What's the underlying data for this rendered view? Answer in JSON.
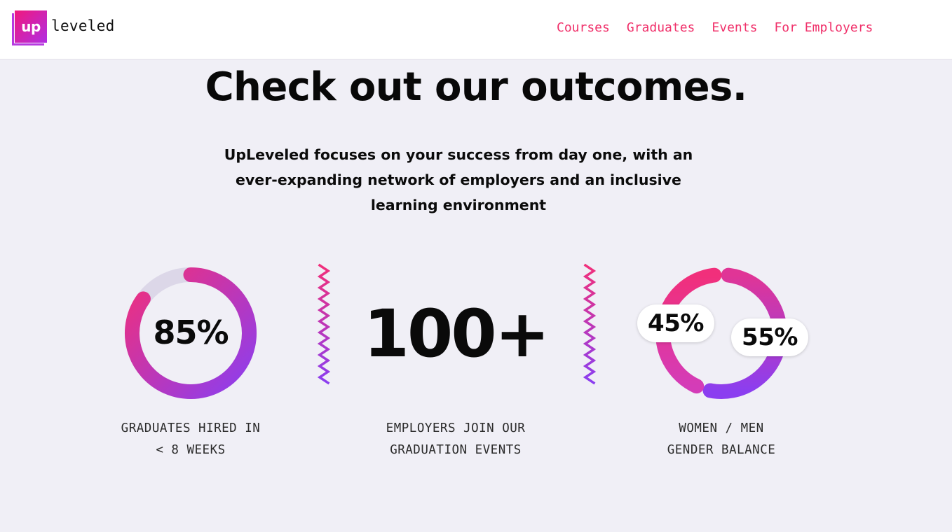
{
  "brand": {
    "logo_mark": "up",
    "logo_word": "leveled"
  },
  "nav": {
    "items": [
      {
        "label": "Courses"
      },
      {
        "label": "Graduates"
      },
      {
        "label": "Events"
      },
      {
        "label": "For Employers"
      }
    ]
  },
  "hero": {
    "title": "Check out our outcomes.",
    "intro": "UpLeveled focuses on your success from day one, with an ever-expanding network of employers and an inclusive learning environment"
  },
  "stats": {
    "hired": {
      "value_label": "85%",
      "fraction": 0.85,
      "caption_line1": "GRADUATES HIRED IN",
      "caption_line2": "< 8 WEEKS"
    },
    "employers": {
      "value_label": "100+",
      "caption_line1": "EMPLOYERS JOIN OUR",
      "caption_line2": "GRADUATION EVENTS"
    },
    "gender": {
      "women_label": "45%",
      "men_label": "55%",
      "women_fraction": 0.45,
      "men_fraction": 0.55,
      "caption_line1": "WOMEN / MEN",
      "caption_line2": "GENDER BALANCE"
    }
  },
  "colors": {
    "pink": "#f12f7b",
    "purple": "#8b3ef0",
    "ring_track": "#dcd7e8",
    "nav_link": "#f0306a",
    "background": "#f0eff6"
  }
}
